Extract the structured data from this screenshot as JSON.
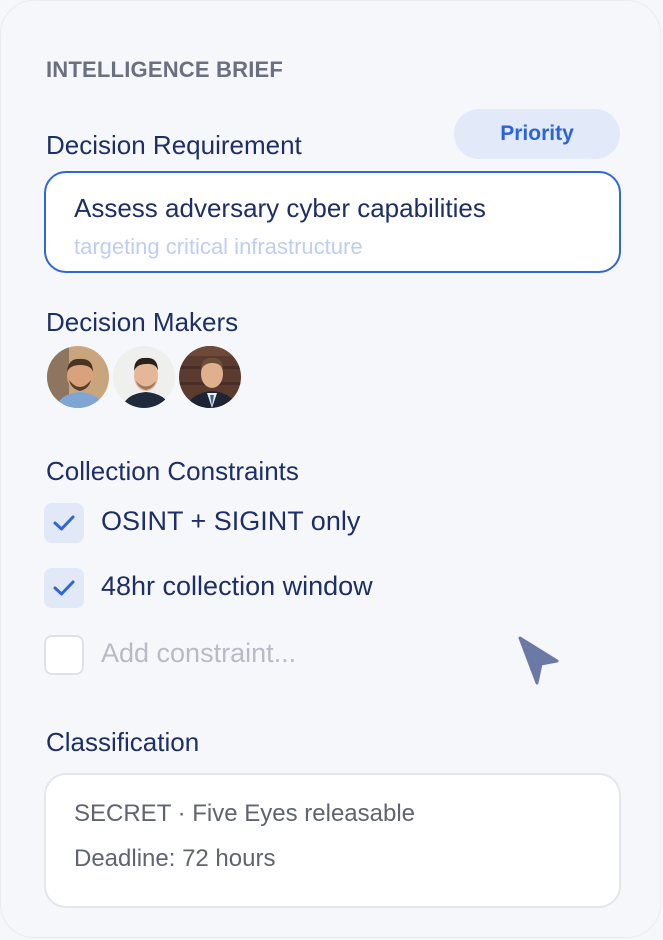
{
  "section_title": "INTELLIGENCE BRIEF",
  "priority_label": "Priority",
  "decision_requirement": {
    "label": "Decision Requirement",
    "value": "Assess adversary cyber capabilities",
    "placeholder": "targeting critical infrastructure"
  },
  "decision_makers": {
    "label": "Decision Makers",
    "avatars": [
      "avatar-1",
      "avatar-2",
      "avatar-3"
    ]
  },
  "collection_constraints": {
    "label": "Collection Constraints",
    "items": [
      {
        "text": "OSINT + SIGINT only",
        "checked": true
      },
      {
        "text": "48hr collection window",
        "checked": true
      }
    ],
    "add_placeholder": "Add constraint..."
  },
  "classification": {
    "label": "Classification",
    "line1": "SECRET · Five Eyes releasable",
    "line2": "Deadline: 72 hours"
  },
  "colors": {
    "accent": "#2f66d8",
    "text": "#1d2f66",
    "checkbox_fill": "#e1e8f7"
  },
  "icons": {
    "check": "check-icon",
    "cursor": "mouse-pointer-icon"
  }
}
